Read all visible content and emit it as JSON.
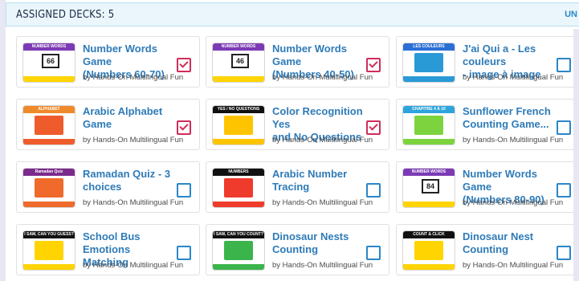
{
  "header": {
    "title": "ASSIGNED DECKS: 5",
    "link_label": "UN"
  },
  "card_author": "by Hands-On Multilingual Fun",
  "decks": [
    {
      "title": "Number Words Game\n(Numbers 60-70)",
      "checked": true,
      "thumb_label": "NUMBER WORDS",
      "thumb_number": "66",
      "band_color": "#7c3bb5",
      "foot_color": "#ffd400"
    },
    {
      "title": "Number Words Game\n(Numbers 40-50)",
      "checked": true,
      "thumb_label": "NUMBER WORDS",
      "thumb_number": "46",
      "band_color": "#7c3bb5",
      "foot_color": "#ffd400"
    },
    {
      "title": "J'ai Qui a - Les couleurs\n- image à image",
      "checked": false,
      "thumb_label": "LES COULEURS",
      "thumb_number": "",
      "band_color": "#2a6fd6",
      "foot_color": "#2a9ad6"
    },
    {
      "title": "Arabic Alphabet Game",
      "checked": true,
      "thumb_label": "ALPHABET",
      "thumb_number": "",
      "band_color": "#ef8a2b",
      "foot_color": "#ef5c2b"
    },
    {
      "title": "Color Recognition Yes\nand No Questions",
      "checked": true,
      "thumb_label": "YES / NO QUESTIONS",
      "thumb_number": "",
      "band_color": "#111111",
      "foot_color": "#ffc400"
    },
    {
      "title": "Sunflower French\nCounting Game...",
      "checked": false,
      "thumb_label": "CHAPITRE 4 À 10",
      "thumb_number": "",
      "band_color": "#2ea4dd",
      "foot_color": "#7dd33e"
    },
    {
      "title": "Ramadan Quiz - 3\nchoices",
      "checked": false,
      "thumb_label": "Ramadan Quiz",
      "thumb_number": "",
      "band_color": "#7c2b8d",
      "foot_color": "#ef6a2b"
    },
    {
      "title": "Arabic Number Tracing",
      "checked": false,
      "thumb_label": "NUMBERS",
      "thumb_number": "",
      "band_color": "#111111",
      "foot_color": "#ef3b2b"
    },
    {
      "title": "Number Words Game\n(Numbers 80-90)",
      "checked": false,
      "thumb_label": "NUMBER WORDS",
      "thumb_number": "84",
      "band_color": "#7c3bb5",
      "foot_color": "#ffd400"
    },
    {
      "title": "School Bus Emotions\nMatching",
      "checked": false,
      "thumb_label": "I SAW, CAN YOU GUESS?",
      "thumb_number": "",
      "band_color": "#111111",
      "foot_color": "#ffd400"
    },
    {
      "title": "Dinosaur Nests\nCounting",
      "checked": false,
      "thumb_label": "I SAW, CAN YOU COUNT?",
      "thumb_number": "",
      "band_color": "#111111",
      "foot_color": "#3bb44b"
    },
    {
      "title": "Dinosaur Nest Counting",
      "checked": false,
      "thumb_label": "COUNT & CLICK",
      "thumb_number": "",
      "band_color": "#111111",
      "foot_color": "#ffd400"
    }
  ]
}
